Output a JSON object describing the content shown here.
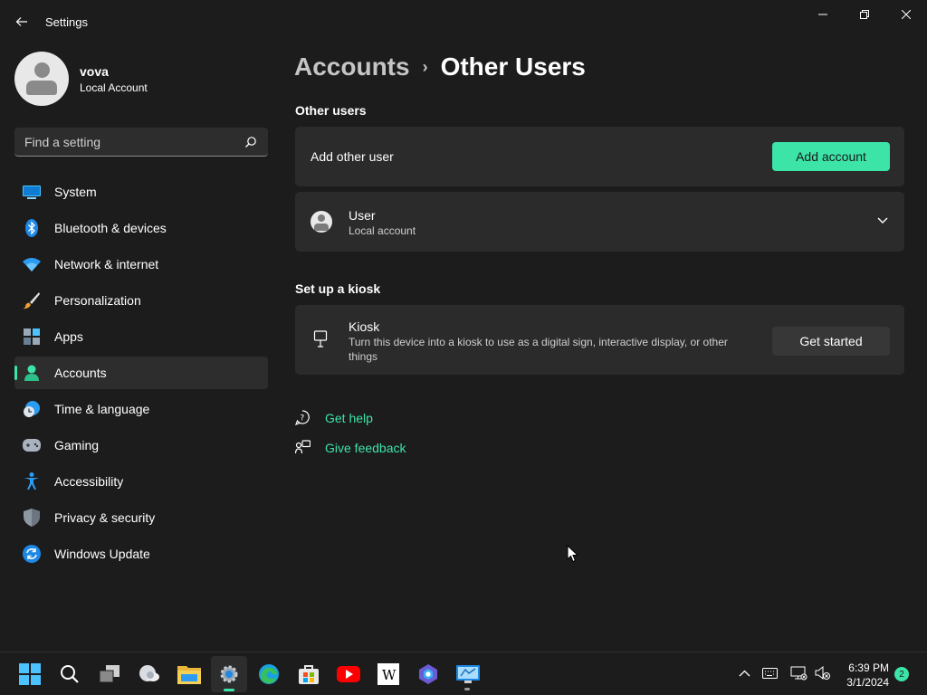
{
  "window": {
    "title": "Settings"
  },
  "profile": {
    "name": "vova",
    "account_type": "Local Account"
  },
  "search": {
    "placeholder": "Find a setting"
  },
  "sidebar": {
    "items": [
      {
        "label": "System",
        "icon": "monitor-icon"
      },
      {
        "label": "Bluetooth & devices",
        "icon": "bluetooth-icon"
      },
      {
        "label": "Network & internet",
        "icon": "wifi-icon"
      },
      {
        "label": "Personalization",
        "icon": "brush-icon"
      },
      {
        "label": "Apps",
        "icon": "apps-icon"
      },
      {
        "label": "Accounts",
        "icon": "person-icon",
        "active": true
      },
      {
        "label": "Time & language",
        "icon": "globe-clock-icon"
      },
      {
        "label": "Gaming",
        "icon": "gamepad-icon"
      },
      {
        "label": "Accessibility",
        "icon": "accessibility-icon"
      },
      {
        "label": "Privacy & security",
        "icon": "shield-icon"
      },
      {
        "label": "Windows Update",
        "icon": "update-icon"
      }
    ]
  },
  "breadcrumb": {
    "parent": "Accounts",
    "separator": "›",
    "current": "Other Users"
  },
  "other_users": {
    "section_title": "Other users",
    "add_row_label": "Add other user",
    "add_button": "Add account",
    "user_name": "User",
    "user_type": "Local account"
  },
  "kiosk": {
    "section_title": "Set up a kiosk",
    "title": "Kiosk",
    "description_line1": "Turn this device into a kiosk to use as a digital sign, interactive display, or other",
    "description_line2": "things",
    "button": "Get started"
  },
  "help": {
    "get_help": "Get help",
    "give_feedback": "Give feedback"
  },
  "taskbar": {
    "time": "6:39 PM",
    "date": "3/1/2024",
    "notification_count": "2"
  },
  "colors": {
    "accent": "#3ce4a8",
    "background": "#1c1c1c",
    "card": "#2b2b2b"
  }
}
